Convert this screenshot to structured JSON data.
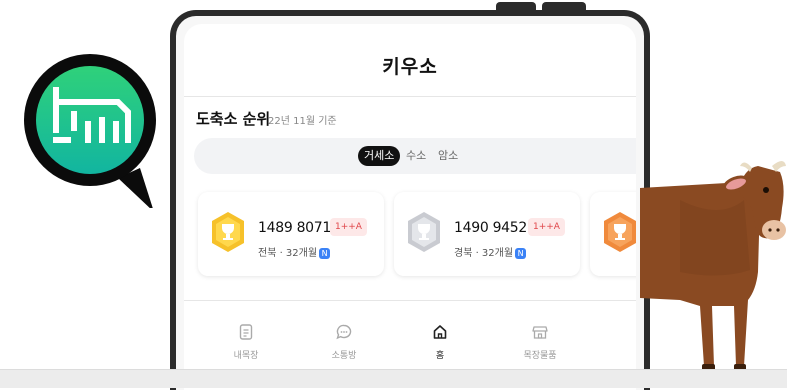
{
  "app": {
    "title": "키우소"
  },
  "ranking": {
    "title": "도축소 순위",
    "subtitle": "22년 11월 기준",
    "tabs": [
      {
        "label": "거세소",
        "active": true
      },
      {
        "label": "수소",
        "active": false
      },
      {
        "label": "암소",
        "active": false
      }
    ],
    "cards": [
      {
        "medal": "gold-medal-icon",
        "number": "1489 8071 7",
        "grade": "1++A",
        "region": "전북 · 32개월",
        "badge": "N"
      },
      {
        "medal": "silver-medal-icon",
        "number": "1490 9452 5",
        "grade": "1++A",
        "region": "경북 · 32개월",
        "badge": "N"
      },
      {
        "medal": "bronze-medal-icon"
      }
    ]
  },
  "nav": {
    "items": [
      {
        "label": "내목장",
        "icon": "document-icon",
        "active": false
      },
      {
        "label": "소통방",
        "icon": "chat-bubble-icon",
        "active": false
      },
      {
        "label": "홈",
        "icon": "home-icon",
        "active": true
      },
      {
        "label": "목장물품",
        "icon": "store-icon",
        "active": false
      }
    ]
  },
  "colors": {
    "logo_gradient_top": "#2fd17a",
    "logo_gradient_bottom": "#12b5a0",
    "logo_ring": "#0b0b0b",
    "grade_text": "#e0464a",
    "grade_bg": "#fde8e8",
    "cow_brown": "#8a4a22"
  }
}
